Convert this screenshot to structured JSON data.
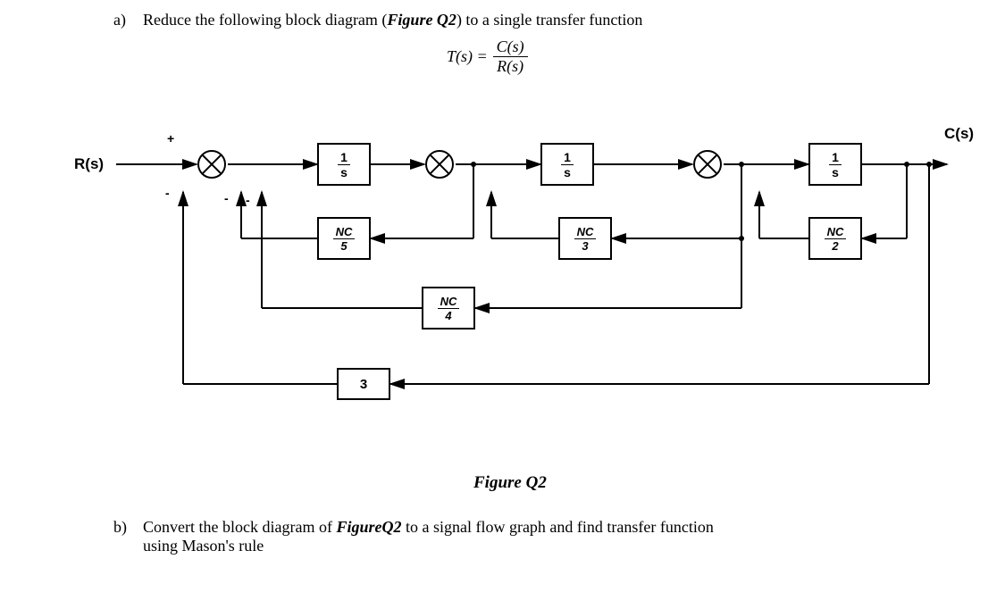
{
  "questionA": {
    "prefix": "a)",
    "text1": "Reduce the following block diagram (",
    "figRef": "Figure Q2",
    "text2": ") to a single transfer function"
  },
  "equation": {
    "lhs": "T(s) =",
    "num": "C(s)",
    "den": "R(s)"
  },
  "labels": {
    "input": "R(s)",
    "output": "C(s)"
  },
  "signs": {
    "plus": "+",
    "minus": "-"
  },
  "blocks": {
    "g1": {
      "num": "1",
      "den": "s"
    },
    "g2": {
      "num": "1",
      "den": "s"
    },
    "g3": {
      "num": "1",
      "den": "s"
    },
    "h1": {
      "num": "NC",
      "den": "5"
    },
    "h2": {
      "num": "NC",
      "den": "3"
    },
    "h3": {
      "num": "NC",
      "den": "2"
    },
    "h4": {
      "num": "NC",
      "den": "4"
    },
    "h5": "3"
  },
  "figCaption": "Figure Q2",
  "questionB": {
    "prefix": "b)",
    "text1": "Convert the block diagram of ",
    "figRef": "FigureQ2",
    "text2": " to a signal flow graph and find transfer function",
    "text3": "using Mason's rule"
  },
  "chart_data": {
    "type": "block-diagram",
    "input": "R(s)",
    "output": "C(s)",
    "forward_blocks": [
      {
        "id": "G1",
        "tf": "1/s"
      },
      {
        "id": "G2",
        "tf": "1/s"
      },
      {
        "id": "G3",
        "tf": "1/s"
      }
    ],
    "feedback_blocks": [
      {
        "id": "H1",
        "tf": "NC/5",
        "from": "after_sum2",
        "to": "sum1",
        "sign": "-"
      },
      {
        "id": "H2",
        "tf": "NC/3",
        "from": "after_sum3",
        "to": "sum2",
        "sign": "?"
      },
      {
        "id": "H3",
        "tf": "NC/2",
        "from": "C(s)",
        "to": "sum3",
        "sign": "?"
      },
      {
        "id": "H4",
        "tf": "NC/4",
        "from": "after_sum3",
        "to": "sum2",
        "sign": "?"
      },
      {
        "id": "H5",
        "tf": "3",
        "from": "C(s)",
        "to": "sum1",
        "sign": "-"
      }
    ],
    "title": "Figure Q2"
  }
}
